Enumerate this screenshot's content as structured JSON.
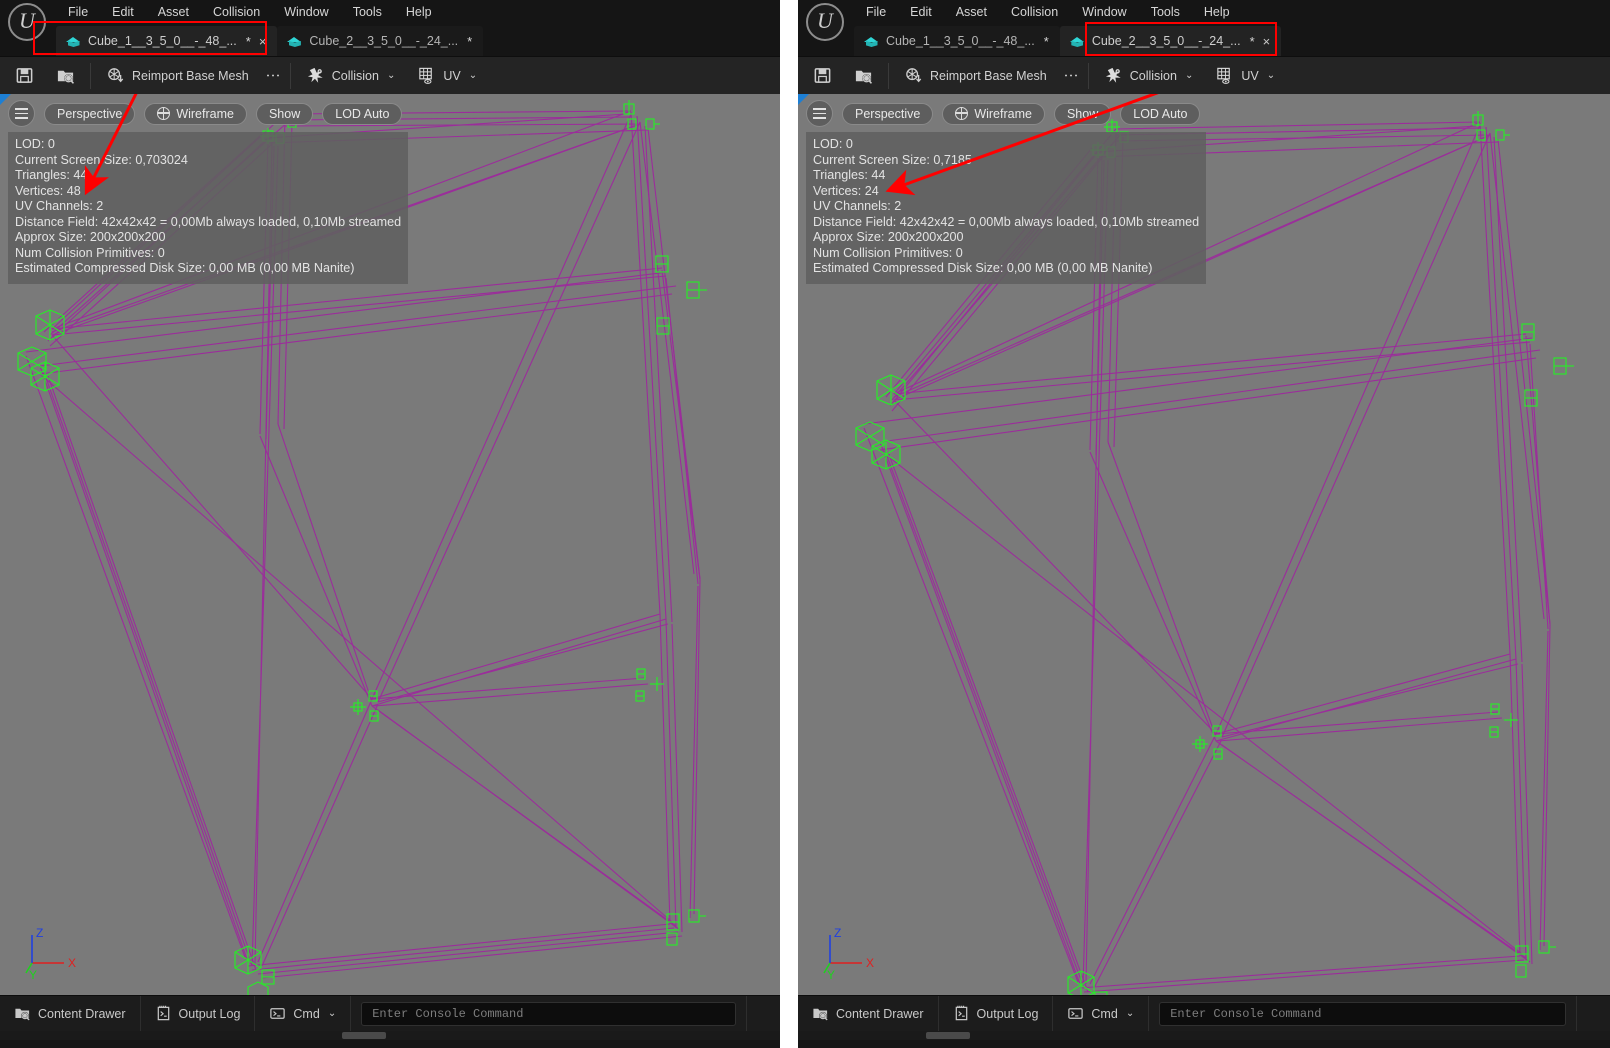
{
  "app": {
    "logo_glyph": "U",
    "menu": [
      "File",
      "Edit",
      "Asset",
      "Collision",
      "Window",
      "Tools",
      "Help"
    ]
  },
  "left_panel": {
    "tabs": [
      {
        "label": "Cube_1__3_5_0__-_48_...",
        "dirty": "*",
        "close": "×",
        "active": true,
        "highlighted": true
      },
      {
        "label": "Cube_2__3_5_0__-_24_...",
        "dirty": "*",
        "close": "",
        "active": false,
        "highlighted": false
      }
    ],
    "toolbar": {
      "save_label": "",
      "browse_label": "",
      "reimport_label": "Reimport Base Mesh",
      "kebab": "⋮",
      "collision_label": "Collision",
      "uv_label": "UV",
      "caret": "⌄"
    },
    "viewport_toolbar": {
      "menu_label": "",
      "perspective_label": "Perspective",
      "wireframe_label": "Wireframe",
      "show_label": "Show",
      "lod_label": "LOD Auto"
    },
    "info": [
      "LOD:  0",
      "Current Screen Size:  0,703024",
      "Triangles:  44",
      "Vertices:  48",
      "UV Channels:  2",
      "Distance Field:  42x42x42 = 0,00Mb always loaded, 0,10Mb streamed",
      "Approx Size: 200x200x200",
      "Num Collision Primitives:  0",
      "Estimated Compressed Disk Size: 0,00 MB (0,00 MB Nanite)"
    ],
    "axis": {
      "x": "X",
      "y": "Y",
      "z": "Z"
    },
    "statusbar": {
      "content_drawer": "Content Drawer",
      "output_log": "Output Log",
      "cmd": "Cmd",
      "caret": "⌄",
      "console_placeholder": "Enter Console Command"
    }
  },
  "right_panel": {
    "tabs": [
      {
        "label": "Cube_1__3_5_0__-_48_...",
        "dirty": "*",
        "close": "",
        "active": false,
        "highlighted": false
      },
      {
        "label": "Cube_2__3_5_0__-_24_...",
        "dirty": "*",
        "close": "×",
        "active": true,
        "highlighted": true
      }
    ],
    "toolbar": {
      "reimport_label": "Reimport Base Mesh",
      "kebab": "⋮",
      "collision_label": "Collision",
      "uv_label": "UV",
      "caret": "⌄"
    },
    "viewport_toolbar": {
      "perspective_label": "Perspective",
      "wireframe_label": "Wireframe",
      "show_label": "Show",
      "lod_label": "LOD Auto"
    },
    "info": [
      "LOD:  0",
      "Current Screen Size:  0,7185",
      "Triangles:  44",
      "Vertices:  24",
      "UV Channels:  2",
      "Distance Field:  42x42x42 = 0,00Mb always loaded, 0,10Mb streamed",
      "Approx Size: 200x200x200",
      "Num Collision Primitives:  0",
      "Estimated Compressed Disk Size: 0,00 MB (0,00 MB Nanite)"
    ],
    "axis": {
      "x": "X",
      "y": "Y",
      "z": "Z"
    },
    "statusbar": {
      "content_drawer": "Content Drawer",
      "output_log": "Output Log",
      "cmd": "Cmd",
      "caret": "⌄",
      "console_placeholder": "Enter Console Command"
    }
  },
  "annotations": {
    "color": "#ff0000",
    "left_arrow": {
      "from": [
        163,
        57
      ],
      "to": [
        86,
        190
      ]
    },
    "right_arrow": {
      "from": [
        1108,
        62
      ],
      "to": [
        888,
        189
      ]
    }
  },
  "colors": {
    "viewport_bg": "#7a7a7a",
    "wire": "#9b2d9b",
    "vertex": "#2ae82a",
    "chrome_dark": "#151515",
    "toolbar": "#242424",
    "accent_red": "#ff0000",
    "tab_teal": "#23b3b3",
    "axis_x": "#e02020",
    "axis_y": "#20d020",
    "axis_z": "#2040e0"
  }
}
